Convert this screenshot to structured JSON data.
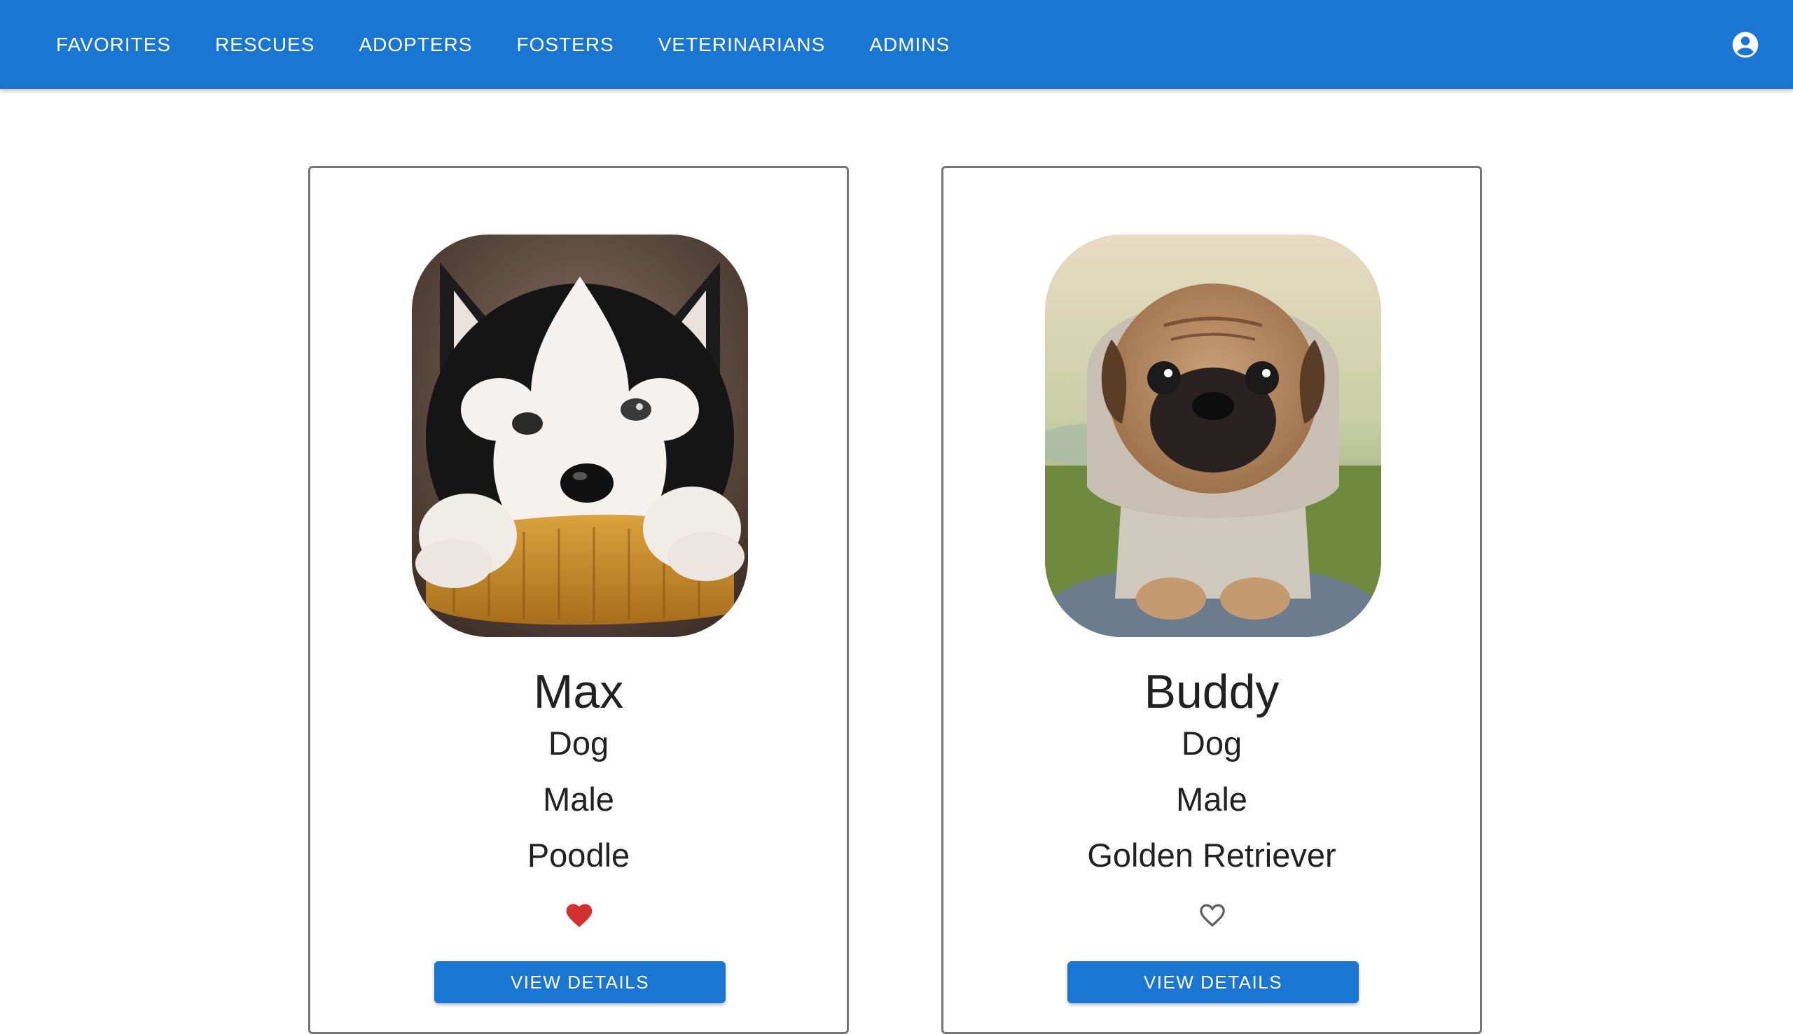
{
  "nav": {
    "items": [
      {
        "label": "FAVORITES"
      },
      {
        "label": "RESCUES"
      },
      {
        "label": "ADOPTERS"
      },
      {
        "label": "FOSTERS"
      },
      {
        "label": "VETERINARIANS"
      },
      {
        "label": "ADMINS"
      }
    ],
    "account_icon": "account-circle-icon"
  },
  "colors": {
    "appbar": "#1976d2",
    "button": "#1976d2",
    "favorite_active": "#d32f2f",
    "favorite_inactive": "#616161"
  },
  "animals": [
    {
      "name": "Max",
      "species": "Dog",
      "gender": "Male",
      "breed": "Poodle",
      "favorited": true,
      "photo": "husky-puppy-photo",
      "button_label": "VIEW DETAILS"
    },
    {
      "name": "Buddy",
      "species": "Dog",
      "gender": "Male",
      "breed": "Golden Retriever",
      "favorited": false,
      "photo": "pug-puppy-photo",
      "button_label": "VIEW DETAILS"
    }
  ]
}
